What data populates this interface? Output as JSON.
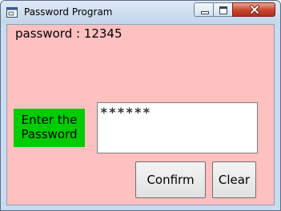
{
  "window": {
    "title": "Password Program",
    "icon": "app-window-icon",
    "controls": {
      "minimize_icon": "minimize-icon",
      "maximize_icon": "maximize-icon",
      "close_icon": "close-icon"
    }
  },
  "form": {
    "info_text": "password : 12345",
    "prompt_text": "Enter the\nPassword",
    "password_value": "******",
    "confirm_label": "Confirm",
    "clear_label": "Clear"
  },
  "colors": {
    "form_background": "#ffc0c0",
    "prompt_background": "#00cc00",
    "close_button": "#c7442d",
    "titlebar": "#c9dcef"
  }
}
